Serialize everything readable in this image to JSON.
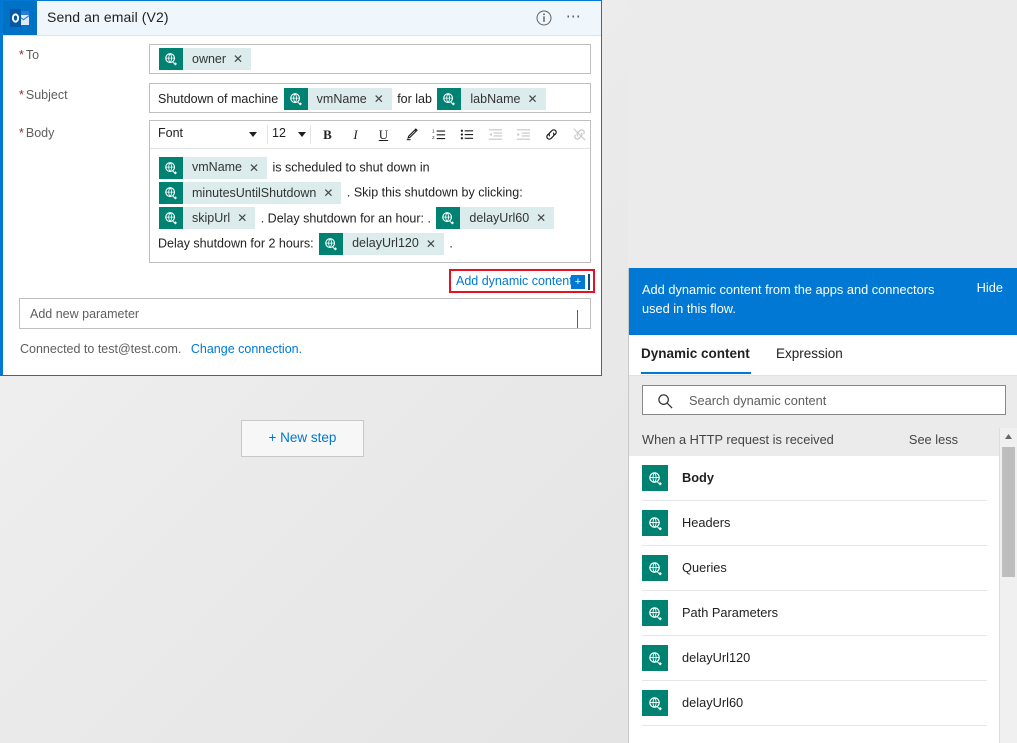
{
  "card": {
    "title": "Send an email (V2)",
    "app_icon": "outlook-icon",
    "info_icon": "info-icon",
    "more_icon": "ellipsis-icon"
  },
  "fields": {
    "to": {
      "label": "To",
      "required": true,
      "tokens": [
        "owner"
      ]
    },
    "subject": {
      "label": "Subject",
      "required": true,
      "parts": [
        {
          "type": "text",
          "value": "Shutdown of machine"
        },
        {
          "type": "token",
          "value": "vmName"
        },
        {
          "type": "text",
          "value": "for lab"
        },
        {
          "type": "token",
          "value": "labName"
        }
      ]
    },
    "body": {
      "label": "Body",
      "required": true,
      "parts": [
        {
          "type": "token",
          "value": "vmName"
        },
        {
          "type": "text",
          "value": "is scheduled to shut down in"
        },
        {
          "type": "token",
          "value": "minutesUntilShutdown"
        },
        {
          "type": "text",
          "value": ". Skip this shutdown by clicking:"
        },
        {
          "type": "token",
          "value": "skipUrl"
        },
        {
          "type": "text",
          "value": ". Delay shutdown for an hour: ."
        },
        {
          "type": "token",
          "value": "delayUrl60"
        },
        {
          "type": "text",
          "value": "Delay shutdown for 2 hours:"
        },
        {
          "type": "token",
          "value": "delayUrl120"
        },
        {
          "type": "text",
          "value": "."
        }
      ]
    }
  },
  "rte_toolbar": {
    "font_value": "Font",
    "size_value": "12",
    "buttons": [
      {
        "name": "bold-icon",
        "glyph": "B"
      },
      {
        "name": "italic-icon",
        "glyph": "I"
      },
      {
        "name": "underline-icon",
        "glyph": "U"
      },
      {
        "name": "highlight-pen-icon",
        "glyph": "✒"
      },
      {
        "name": "numbered-list-icon",
        "glyph": "≣"
      },
      {
        "name": "bullet-list-icon",
        "glyph": "≣"
      },
      {
        "name": "decrease-indent-icon",
        "glyph": "≣"
      },
      {
        "name": "increase-indent-icon",
        "glyph": "≣"
      },
      {
        "name": "link-icon",
        "glyph": "⚭"
      },
      {
        "name": "unlink-icon",
        "glyph": "⚮"
      }
    ]
  },
  "add_dynamic_content": {
    "label": "Add dynamic content",
    "plus": "+",
    "highlight_color": "#e81123"
  },
  "add_parameter": {
    "label": "Add new parameter"
  },
  "connection": {
    "text": "Connected to test@test.com.",
    "link": "Change connection."
  },
  "new_step": {
    "label": "+ New step"
  },
  "dynamic_panel": {
    "banner_text": "Add dynamic content from the apps and connectors used in this flow.",
    "hide_label": "Hide",
    "tabs": [
      {
        "label": "Dynamic content",
        "active": true
      },
      {
        "label": "Expression",
        "active": false
      }
    ],
    "search_placeholder": "Search dynamic content",
    "group_title": "When a HTTP request is received",
    "see_less_label": "See less",
    "items": [
      {
        "label": "Body"
      },
      {
        "label": "Headers"
      },
      {
        "label": "Queries"
      },
      {
        "label": "Path Parameters"
      },
      {
        "label": "delayUrl120"
      },
      {
        "label": "delayUrl60"
      }
    ]
  },
  "colors": {
    "accent_blue": "#0078d4",
    "token_teal": "#008272",
    "token_bg": "#dcecec",
    "required_red": "#a4262c",
    "highlight_red": "#e81123"
  }
}
